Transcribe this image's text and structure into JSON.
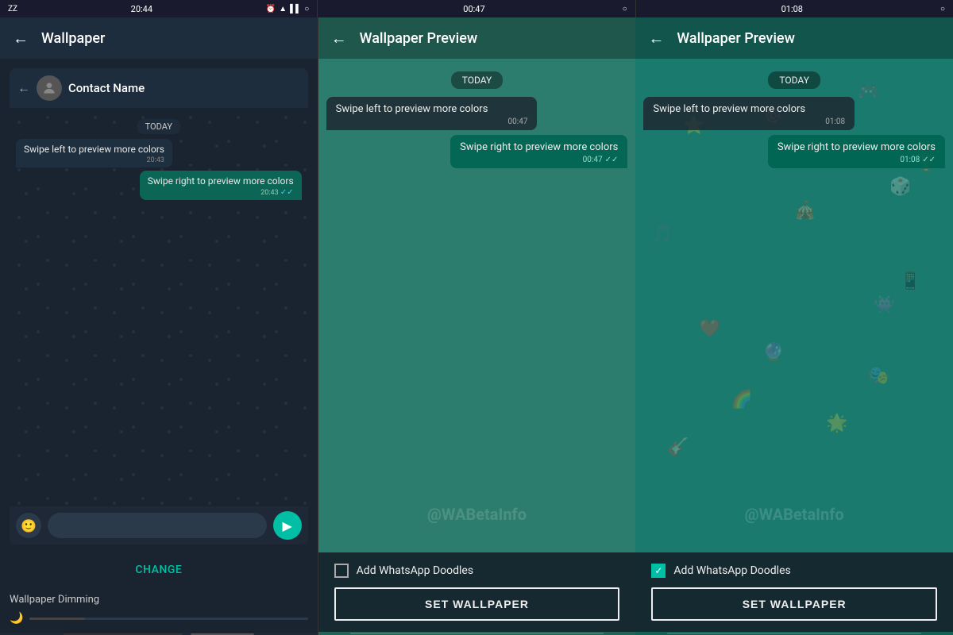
{
  "panels": [
    {
      "id": "wallpaper-settings",
      "status_time": "20:44",
      "status_left_icons": [
        "zz",
        "battery"
      ],
      "status_right_icons": [
        "alarm",
        "wifi",
        "signal",
        "circle"
      ],
      "appbar_title": "Wallpaper",
      "chat": {
        "contact_name": "Contact Name",
        "date_label": "TODAY",
        "messages": [
          {
            "type": "received",
            "text": "Swipe left to preview more colors",
            "time": "20:43"
          },
          {
            "type": "sent",
            "text": "Swipe right to preview more colors",
            "time": "20:43",
            "ticks": "✓✓"
          }
        ]
      },
      "change_label": "CHANGE",
      "dimming_label": "Wallpaper Dimming"
    },
    {
      "id": "wallpaper-preview-plain",
      "status_time": "00:47",
      "appbar_title": "Wallpaper Preview",
      "chat": {
        "date_label": "TODAY",
        "messages": [
          {
            "type": "received",
            "text": "Swipe left to preview more colors",
            "time": "00:47"
          },
          {
            "type": "sent",
            "text": "Swipe right to preview more colors",
            "time": "00:47",
            "ticks": "✓✓"
          }
        ]
      },
      "doodles_checked": false,
      "checkbox_label": "Add WhatsApp Doodles",
      "set_wallpaper_label": "SET WALLPAPER",
      "watermark": "@WABetaInfo"
    },
    {
      "id": "wallpaper-preview-doodles",
      "status_time": "01:08",
      "appbar_title": "Wallpaper Preview",
      "chat": {
        "date_label": "TODAY",
        "messages": [
          {
            "type": "received",
            "text": "Swipe left to preview more colors",
            "time": "01:08"
          },
          {
            "type": "sent",
            "text": "Swipe right to preview more colors",
            "time": "01:08",
            "ticks": "✓✓"
          }
        ]
      },
      "doodles_checked": true,
      "checkbox_label": "Add WhatsApp Doodles",
      "set_wallpaper_label": "SET WALLPAPER",
      "watermark": "@WABetaInfo"
    }
  ]
}
